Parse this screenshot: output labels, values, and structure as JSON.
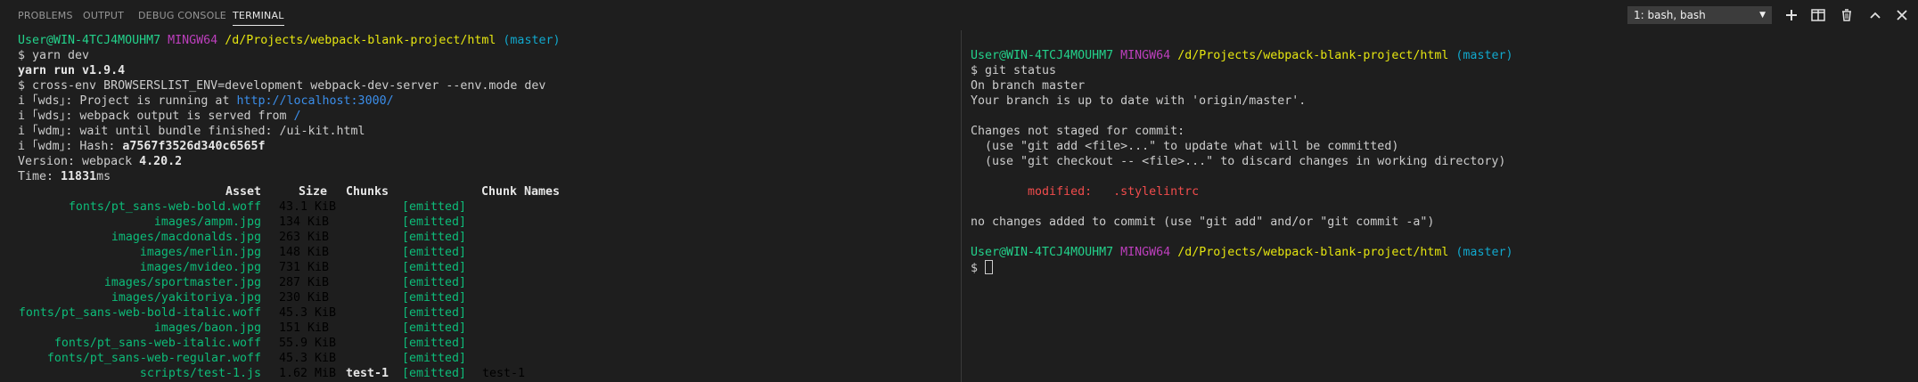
{
  "tabs": [
    {
      "label": "PROBLEMS"
    },
    {
      "label": "OUTPUT"
    },
    {
      "label": "DEBUG CONSOLE"
    },
    {
      "label": "TERMINAL"
    }
  ],
  "terminal_select": {
    "value": "1: bash, bash"
  },
  "toolbar": {
    "new_terminal_icon": "plus-icon",
    "split_icon": "split-icon",
    "kill_icon": "trash-icon",
    "maximize_icon": "chevron-up-icon",
    "close_icon": "close-icon"
  },
  "left": {
    "prompt": {
      "user": "User@WIN-4TCJ4MOUHM7",
      "shell": "MINGW64",
      "path": "/d/Projects/webpack-blank-project/html",
      "branch": "(master)"
    },
    "cmd1": "$ yarn dev",
    "yarn_version": "yarn run v1.9.4",
    "cmd2": "$ cross-env BROWSERSLIST_ENV=development webpack-dev-server --env.mode dev",
    "wds1_prefix": "i ｢wds｣: Project is running at ",
    "wds1_url": "http://localhost:3000/",
    "wds2_prefix": "i ｢wds｣: webpack output is served from ",
    "wds2_path": "/",
    "wdm1": "i ｢wdm｣: wait until bundle finished: /ui-kit.html",
    "wdm2_prefix": "i ｢wdm｣: Hash: ",
    "wdm2_hash": "a7567f3526d340c6565f",
    "version_prefix": "Version: webpack ",
    "version_value": "4.20.2",
    "time_prefix": "Time: ",
    "time_value": "11831",
    "time_unit": "ms",
    "headers": {
      "asset": "Asset",
      "size": "Size",
      "chunks": "Chunks",
      "chunk_names": "Chunk Names"
    },
    "assets": [
      {
        "name": "fonts/pt_sans-web-bold.woff",
        "size": "43.1 KiB",
        "chunks": "",
        "status": "[emitted]",
        "chunk_names": ""
      },
      {
        "name": "images/ampm.jpg",
        "size": "134 KiB",
        "chunks": "",
        "status": "[emitted]",
        "chunk_names": ""
      },
      {
        "name": "images/macdonalds.jpg",
        "size": "263 KiB",
        "chunks": "",
        "status": "[emitted]",
        "chunk_names": ""
      },
      {
        "name": "images/merlin.jpg",
        "size": "148 KiB",
        "chunks": "",
        "status": "[emitted]",
        "chunk_names": ""
      },
      {
        "name": "images/mvideo.jpg",
        "size": "731 KiB",
        "chunks": "",
        "status": "[emitted]",
        "chunk_names": ""
      },
      {
        "name": "images/sportmaster.jpg",
        "size": "287 KiB",
        "chunks": "",
        "status": "[emitted]",
        "chunk_names": ""
      },
      {
        "name": "images/yakitoriya.jpg",
        "size": "230 KiB",
        "chunks": "",
        "status": "[emitted]",
        "chunk_names": ""
      },
      {
        "name": "fonts/pt_sans-web-bold-italic.woff",
        "size": "45.3 KiB",
        "chunks": "",
        "status": "[emitted]",
        "chunk_names": ""
      },
      {
        "name": "images/baon.jpg",
        "size": "151 KiB",
        "chunks": "",
        "status": "[emitted]",
        "chunk_names": ""
      },
      {
        "name": "fonts/pt_sans-web-italic.woff",
        "size": "55.9 KiB",
        "chunks": "",
        "status": "[emitted]",
        "chunk_names": ""
      },
      {
        "name": "fonts/pt_sans-web-regular.woff",
        "size": "45.3 KiB",
        "chunks": "",
        "status": "[emitted]",
        "chunk_names": ""
      },
      {
        "name": "scripts/test-1.js",
        "size": "1.62 MiB",
        "chunks": "test-1",
        "status": "[emitted]",
        "chunk_names": "test-1"
      }
    ]
  },
  "right": {
    "prompt": {
      "user": "User@WIN-4TCJ4MOUHM7",
      "shell": "MINGW64",
      "path": "/d/Projects/webpack-blank-project/html",
      "branch": "(master)"
    },
    "cmd": "$ git status",
    "l1": "On branch master",
    "l2": "Your branch is up to date with 'origin/master'.",
    "l3": "Changes not staged for commit:",
    "l4": "  (use \"git add <file>...\" to update what will be committed)",
    "l5": "  (use \"git checkout -- <file>...\" to discard changes in working directory)",
    "modified_label": "        modified:   ",
    "modified_file": ".stylelintrc",
    "l6": "no changes added to commit (use \"git add\" and/or \"git commit -a\")",
    "prompt_char": "$ "
  }
}
